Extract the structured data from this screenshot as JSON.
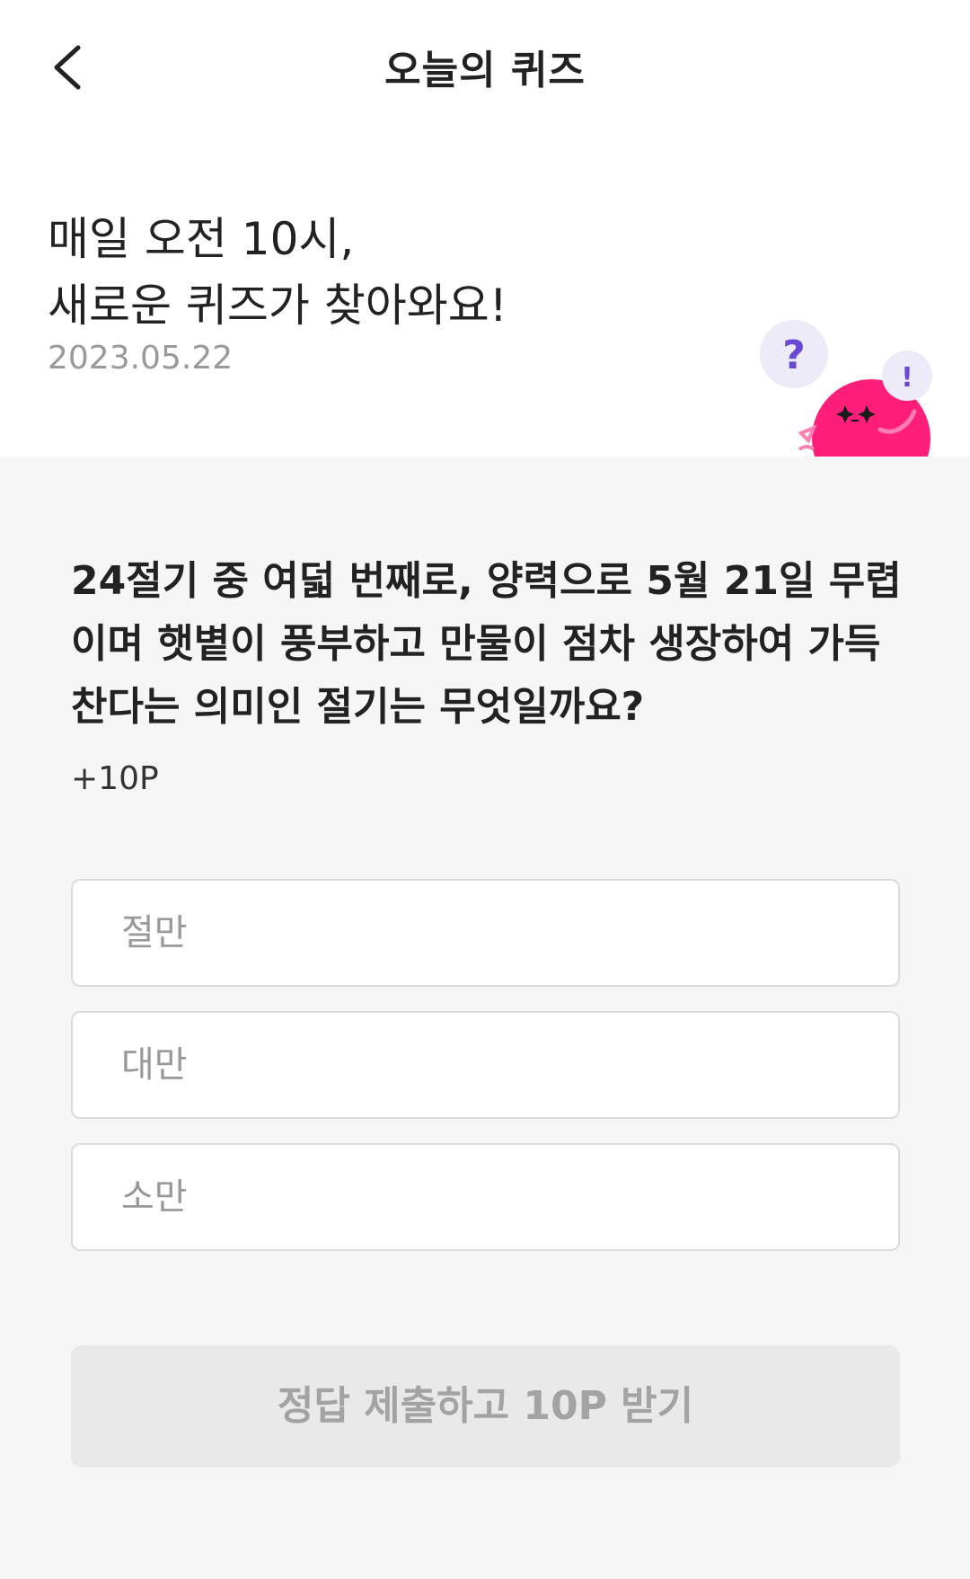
{
  "header": {
    "title": "오늘의 퀴즈",
    "back_icon": "chevron-left-icon"
  },
  "intro": {
    "line1": "매일 오전 10시,",
    "line2": "새로운 퀴즈가 찾아와요!",
    "date": "2023.05.22",
    "bubble_question": "?",
    "bubble_exclaim": "!",
    "mascot_color": "#ff1f7a",
    "bubble_color": "#ecebf7",
    "question_mark_color": "#6b48d6"
  },
  "quiz": {
    "question": "24절기 중 여덟 번째로, 양력으로 5월 21일 무렵이며 햇볕이 풍부하고 만물이 점차 생장하여 가득 찬다는 의미인 절기는 무엇일까요?",
    "points": "+10P",
    "options": [
      {
        "label": "절만"
      },
      {
        "label": "대만"
      },
      {
        "label": "소만"
      }
    ],
    "submit_label": "정답 제출하고 10P 받기"
  }
}
